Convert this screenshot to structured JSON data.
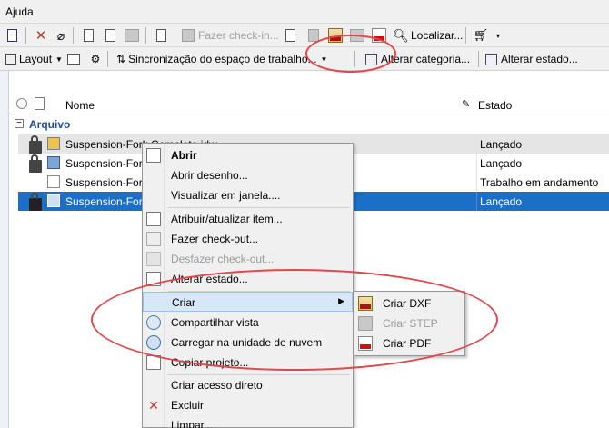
{
  "menubar": {
    "help": "Ajuda"
  },
  "toolbar1": {
    "checkin": "Fazer check-in...",
    "localize": "Localizar..."
  },
  "toolbar2": {
    "layout": "Layout",
    "sync": "Sincronização do espaço de trabalho...",
    "change_category": "Alterar categoria...",
    "change_state": "Alterar estado..."
  },
  "grid": {
    "header_name": "Nome",
    "header_state": "Estado",
    "group_label": "Arquivo",
    "rows": [
      {
        "name": "Suspension-Fork Complete.idw",
        "state": "Lançado"
      },
      {
        "name": "Suspension-Fork",
        "state": "Lançado"
      },
      {
        "name": "Suspension-Fork",
        "state": "Trabalho em andamento"
      },
      {
        "name": "Suspension-Fork",
        "state": "Lançado"
      }
    ]
  },
  "context_menu": {
    "items": [
      {
        "label": "Abrir"
      },
      {
        "label": "Abrir desenho..."
      },
      {
        "label": "Visualizar em janela...."
      },
      {
        "label": "Atribuir/atualizar item..."
      },
      {
        "label": "Fazer check-out..."
      },
      {
        "label": "Desfazer check-out..."
      },
      {
        "label": "Alterar estado..."
      },
      {
        "label": "Criar"
      },
      {
        "label": "Compartilhar vista"
      },
      {
        "label": "Carregar na unidade de nuvem"
      },
      {
        "label": "Copiar projeto..."
      },
      {
        "label": "Criar acesso direto"
      },
      {
        "label": "Excluir"
      },
      {
        "label": "Limpar..."
      }
    ]
  },
  "submenu": {
    "items": [
      {
        "label": "Criar DXF"
      },
      {
        "label": "Criar STEP"
      },
      {
        "label": "Criar PDF"
      }
    ]
  },
  "colors": {
    "annotation": "#e0474c",
    "selection": "#1c6fc7",
    "group_text": "#1f4e9c"
  }
}
